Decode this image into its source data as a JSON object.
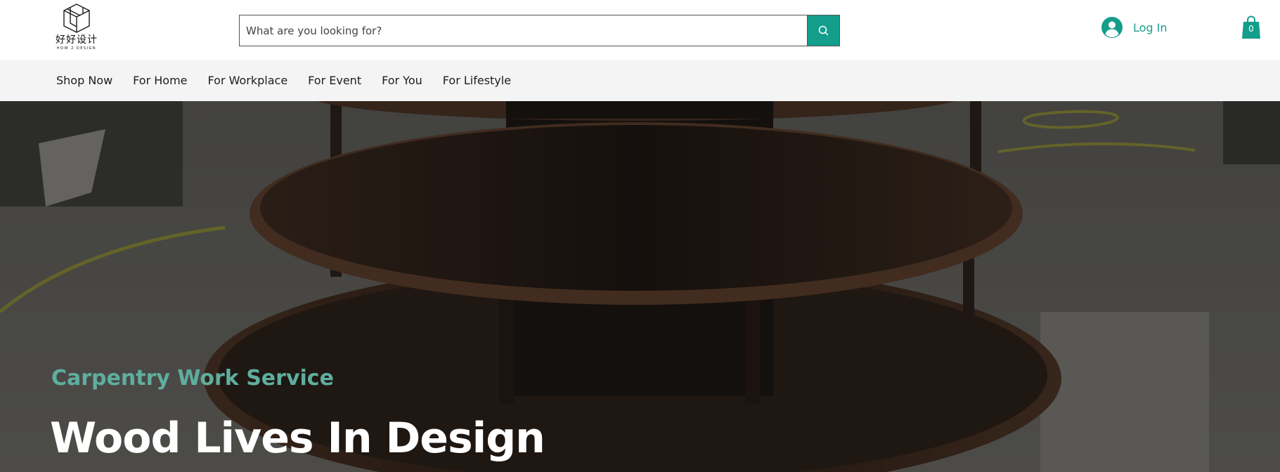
{
  "brand": {
    "logo_cn": "好好设计",
    "logo_en": "HOW 2 DESIGN"
  },
  "search": {
    "placeholder": "What are you looking for?",
    "icon": "search-icon"
  },
  "account": {
    "login_label": "Log In",
    "icon": "user-avatar-icon"
  },
  "cart": {
    "count": "0",
    "icon": "shopping-bag-icon"
  },
  "nav": {
    "items": [
      {
        "label": "Shop Now"
      },
      {
        "label": "For Home"
      },
      {
        "label": "For Workplace"
      },
      {
        "label": "For Event"
      },
      {
        "label": "For You"
      },
      {
        "label": "For Lifestyle"
      }
    ]
  },
  "hero": {
    "subtitle": "Carpentry Work Service",
    "title": "Wood Lives In Design"
  },
  "colors": {
    "accent": "#139d8b",
    "accent_text": "#1a9e8c",
    "hero_subtitle": "#5fae9f",
    "nav_bg": "#f4f4f4"
  }
}
